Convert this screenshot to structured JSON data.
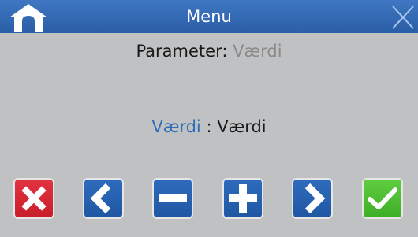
{
  "header": {
    "title": "Menu",
    "home_icon": "home-icon",
    "close_icon": "close-icon"
  },
  "parameter": {
    "label": "Parameter:",
    "value": "Værdi"
  },
  "current": {
    "name": "Værdi",
    "separator": ":",
    "value": "Værdi"
  },
  "toolbar": {
    "buttons": [
      {
        "icon": "cancel-x-icon",
        "color": "#d4222f"
      },
      {
        "icon": "chevron-left-icon",
        "color": "#2660ad"
      },
      {
        "icon": "minus-icon",
        "color": "#2660ad"
      },
      {
        "icon": "plus-icon",
        "color": "#2660ad"
      },
      {
        "icon": "chevron-right-icon",
        "color": "#2660ad"
      },
      {
        "icon": "checkmark-icon",
        "color": "#4cbd32"
      }
    ]
  },
  "colors": {
    "header_bg": "#3366b3",
    "body_bg": "#c0c1c3",
    "accent_blue": "#2f6eb8",
    "muted_text": "#8a8a8a"
  }
}
